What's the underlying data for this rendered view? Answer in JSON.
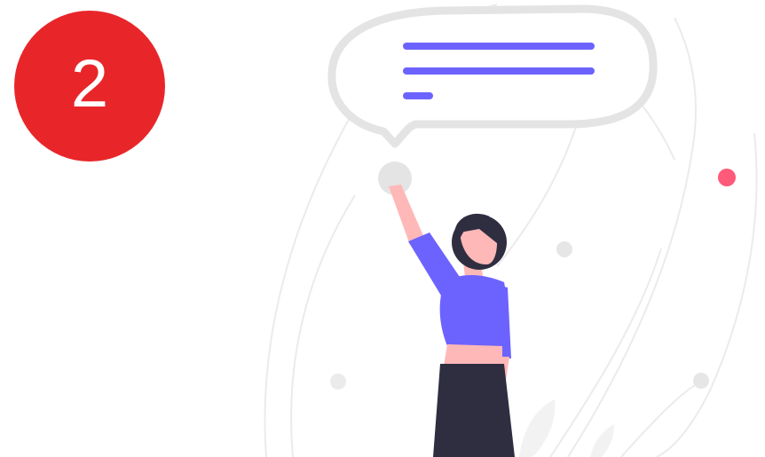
{
  "step": {
    "number": "2",
    "badge_color": "#e8262a"
  },
  "illustration": {
    "icon": "woman-speech-bubble-illustration",
    "accent_color": "#6c63ff",
    "line_color": "#ebebeb",
    "dot_color": "#ff5a7a",
    "hair_color": "#2f2e41",
    "skin_color": "#ffb8b8"
  }
}
